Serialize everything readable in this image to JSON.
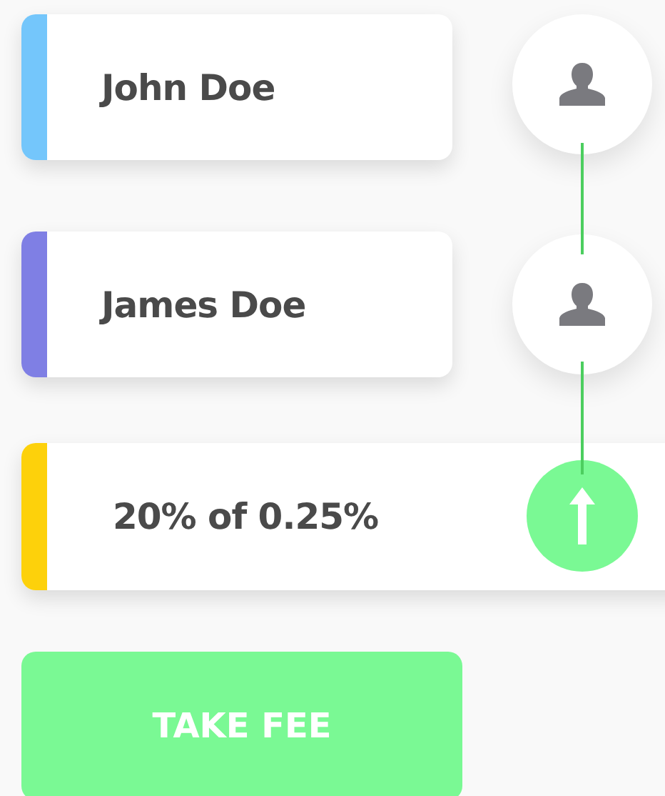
{
  "steps": [
    {
      "kind": "person",
      "label": "John Doe",
      "color": "#74c6fb"
    },
    {
      "kind": "person",
      "label": "James Doe",
      "color": "#7f7fe4"
    },
    {
      "kind": "fee",
      "label": "20% of 0.25%",
      "color": "#fdd10b"
    }
  ],
  "button": {
    "label": "TAKE FEE"
  }
}
